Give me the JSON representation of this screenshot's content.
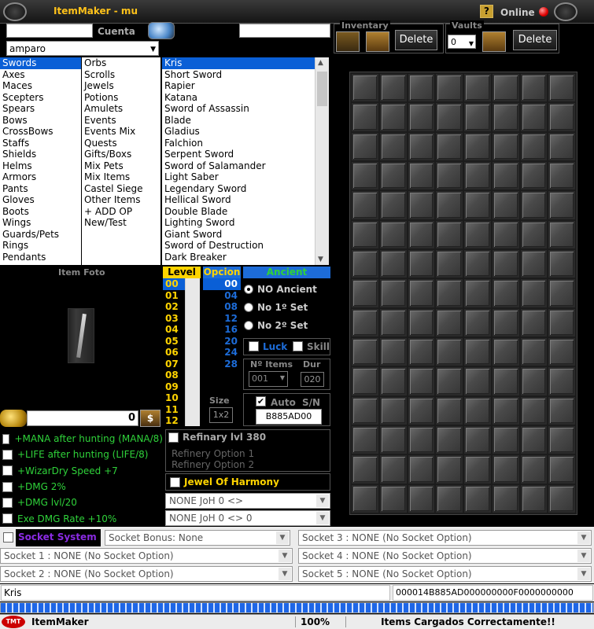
{
  "window": {
    "title": "ItemMaker - mu",
    "online_label": "Online",
    "help_glyph": "?"
  },
  "account": {
    "label": "Cuenta",
    "account_value": "",
    "character_value": "amparo",
    "right_field": ""
  },
  "inventory": {
    "label": "Inventary",
    "delete_label": "Delete"
  },
  "vaults": {
    "label": "Vaults",
    "selected": "0",
    "delete_label": "Delete"
  },
  "categories_left": [
    "Swords",
    "Axes",
    "Maces",
    "Scepters",
    "Spears",
    "Bows",
    "CrossBows",
    "Staffs",
    "Shields",
    "Helms",
    "Armors",
    "Pants",
    "Gloves",
    "Boots",
    "Wings",
    "Guards/Pets",
    "Rings",
    "Pendants"
  ],
  "categories_right": [
    "Orbs",
    "Scrolls",
    "Jewels",
    "Potions",
    "Amulets",
    "Events",
    "Events Mix",
    "Quests",
    "Gifts/Boxs",
    "Mix Pets",
    "Mix Items",
    "Castel Siege",
    "Other Items",
    "+ ADD OP",
    "New/Test"
  ],
  "items": [
    "Kris",
    "Short Sword",
    "Rapier",
    "Katana",
    "Sword of Assassin",
    "Blade",
    "Gladius",
    "Falchion",
    "Serpent Sword",
    "Sword of Salamander",
    "Light Saber",
    "Legendary Sword",
    "Hellical Sword",
    "Double Blade",
    "Lighting Sword",
    "Giant Sword",
    "Sword of Destruction",
    "Dark Breaker"
  ],
  "item_photo": {
    "label": "Item Foto"
  },
  "zen": {
    "value": "0"
  },
  "level": {
    "label": "Level",
    "values": [
      "00",
      "01",
      "02",
      "03",
      "04",
      "05",
      "06",
      "07",
      "08",
      "09",
      "10",
      "11",
      "12"
    ]
  },
  "option": {
    "label": "Opcion",
    "values": [
      "00",
      "04",
      "08",
      "12",
      "16",
      "20",
      "24",
      "28"
    ]
  },
  "ancient": {
    "label": "Ancient",
    "options": [
      "NO Ancient",
      "No 1º Set",
      "No 2º Set"
    ]
  },
  "flags": {
    "luck": "Luck",
    "skill": "Skill"
  },
  "num_items": {
    "label": "Nº Items",
    "value": "001"
  },
  "dur": {
    "label": "Dur",
    "value": "020"
  },
  "size": {
    "label": "Size",
    "value": "1x2"
  },
  "serial": {
    "auto_label": "Auto",
    "sn_label": "S/N",
    "value": "B885AD00"
  },
  "excellent": [
    "+MANA after hunting (MANA/8)",
    "+LIFE after hunting (LIFE/8)",
    "+WizarDry Speed +7",
    "+DMG 2%",
    "+DMG lvl/20",
    "Exe DMG Rate +10%"
  ],
  "refinery": {
    "label": "Refinary lvl 380",
    "opt1": "Refinery Option 1",
    "opt2": "Refinery Option 2"
  },
  "harmony": {
    "label": "Jewel Of Harmony",
    "combo1": "NONE JoH 0 <>",
    "combo2": "NONE JoH 0 <> 0"
  },
  "sockets": {
    "label": "Socket System",
    "bonus": "Socket Bonus: None",
    "s1": "Socket 1 : NONE (No Socket Option)",
    "s2": "Socket 2 : NONE (No Socket Option)",
    "s3": "Socket 3 : NONE (No Socket Option)",
    "s4": "Socket 4 : NONE (No Socket Option)",
    "s5": "Socket 5 : NONE (No Socket Option)"
  },
  "footer": {
    "item_name": "Kris",
    "hex": "000014B885AD000000000F0000000000"
  },
  "progress": {
    "percent_value": 1.0
  },
  "status": {
    "app": "ItemMaker",
    "percent": "100%",
    "message": "Items Cargados Correctamente!!",
    "logo": "TMT"
  }
}
